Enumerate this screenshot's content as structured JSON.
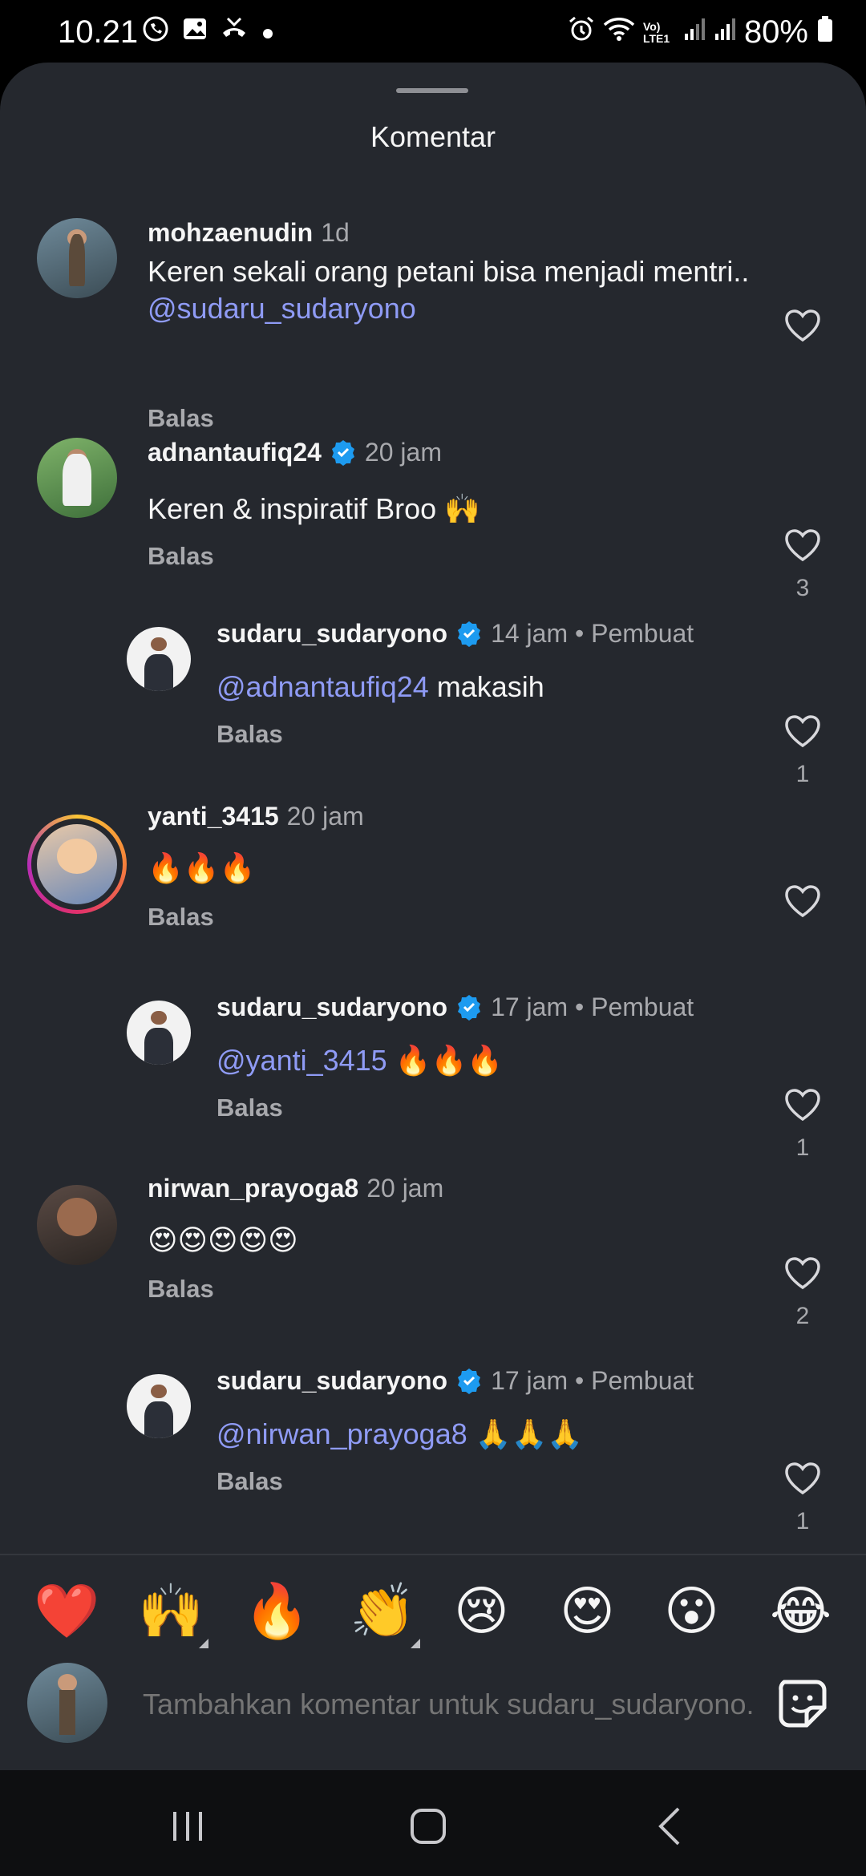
{
  "status_bar": {
    "time": "10.21",
    "battery": "80%",
    "network_label": "Vo) LTE1",
    "left_icons": [
      "whatsapp-icon",
      "gallery-icon",
      "missed-call-icon",
      "dot-icon"
    ],
    "right_icons": [
      "alarm-icon",
      "wifi-icon",
      "signal-icon",
      "signal-icon",
      "battery-icon"
    ]
  },
  "sheet": {
    "title": "Komentar"
  },
  "comments": [
    {
      "user": "mohzaenudin",
      "time": "1d",
      "verified": false,
      "creator": "",
      "text_plain": "Keren sekali orang petani bisa menjadi mentri.. ",
      "mention": "@sudaru_sudaryono",
      "reply": "Balas",
      "likes": ""
    },
    {
      "user": "adnantaufiq24",
      "time": "20 jam",
      "verified": true,
      "creator": "",
      "text_plain": "Keren & inspiratif Broo 🙌",
      "mention": "",
      "reply": "Balas",
      "likes": "3"
    },
    {
      "user": "sudaru_sudaryono",
      "time": "14 jam",
      "verified": true,
      "creator": "• Pembuat",
      "mention": "@adnantaufiq24",
      "text_plain": " makasih",
      "reply": "Balas",
      "likes": "1"
    },
    {
      "user": "yanti_3415",
      "time": "20 jam",
      "verified": false,
      "creator": "",
      "text_plain": "🔥🔥🔥",
      "mention": "",
      "reply": "Balas",
      "likes": ""
    },
    {
      "user": "sudaru_sudaryono",
      "time": "17 jam",
      "verified": true,
      "creator": "• Pembuat",
      "mention": "@yanti_3415",
      "text_plain": " 🔥🔥🔥",
      "reply": "Balas",
      "likes": "1"
    },
    {
      "user": "nirwan_prayoga8",
      "time": "20 jam",
      "verified": false,
      "creator": "",
      "text_plain": "😍😍😍😍😍",
      "mention": "",
      "reply": "Balas",
      "likes": "2"
    },
    {
      "user": "sudaru_sudaryono",
      "time": "17 jam",
      "verified": true,
      "creator": "• Pembuat",
      "mention": "@nirwan_prayoga8",
      "text_plain": " 🙏🙏🙏",
      "reply": "Balas",
      "likes": "1"
    }
  ],
  "emoji_bar": [
    "❤️",
    "🙌",
    "🔥",
    "👏",
    "😢",
    "😍",
    "😮",
    "😂"
  ],
  "input": {
    "placeholder": "Tambahkan komentar untuk sudaru_sudaryono..."
  },
  "colors": {
    "background": "#25282e",
    "mention": "#8f9bf5",
    "verified": "#1d9bf0",
    "muted": "#a8a9ad"
  }
}
